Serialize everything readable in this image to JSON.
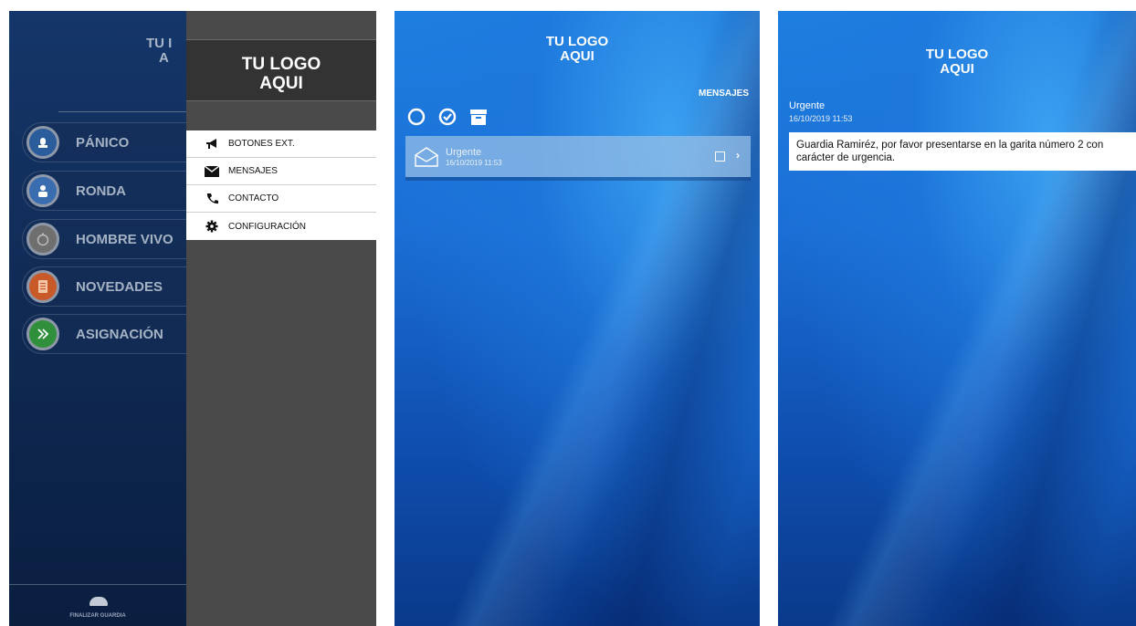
{
  "screen1": {
    "logo_line1": "TU LOGO",
    "logo_line2": "AQUI",
    "dim_logo_line1": "TU I",
    "dim_logo_line2": "A",
    "home_buttons": [
      {
        "label": "PÁNICO",
        "icon": "siren-icon",
        "color": "#2b5c9c"
      },
      {
        "label": "RONDA",
        "icon": "guard-icon",
        "color": "#3a6db0"
      },
      {
        "label": "HOMBRE VIVO",
        "icon": "stopwatch-icon",
        "color": "#6f6f6f"
      },
      {
        "label": "NOVEDADES",
        "icon": "document-icon",
        "color": "#c85a2a"
      },
      {
        "label": "ASIGNACIÓN",
        "icon": "double-chevron-icon",
        "color": "#2f8f3a"
      }
    ],
    "footer_label": "FINALIZAR GUARDIA",
    "drawer_items": [
      {
        "label": "BOTONES EXT.",
        "icon": "megaphone-icon"
      },
      {
        "label": "MENSAJES",
        "icon": "envelope-icon"
      },
      {
        "label": "CONTACTO",
        "icon": "phone-icon"
      },
      {
        "label": "CONFIGURACIÓN",
        "icon": "gear-icon"
      }
    ]
  },
  "screen2": {
    "logo_line1": "TU LOGO",
    "logo_line2": "AQUI",
    "title": "MENSAJES",
    "tools": [
      "circle-icon",
      "check-circle-icon",
      "archive-icon"
    ],
    "messages": [
      {
        "subject": "Urgente",
        "date": "16/10/2019 11:53"
      }
    ]
  },
  "screen3": {
    "logo_line1": "TU LOGO",
    "logo_line2": "AQUI",
    "subject": "Urgente",
    "date": "16/10/2019 11:53",
    "body": "Guardia Ramiréz, por favor presentarse en la garita número 2 con carácter de urgencia."
  }
}
